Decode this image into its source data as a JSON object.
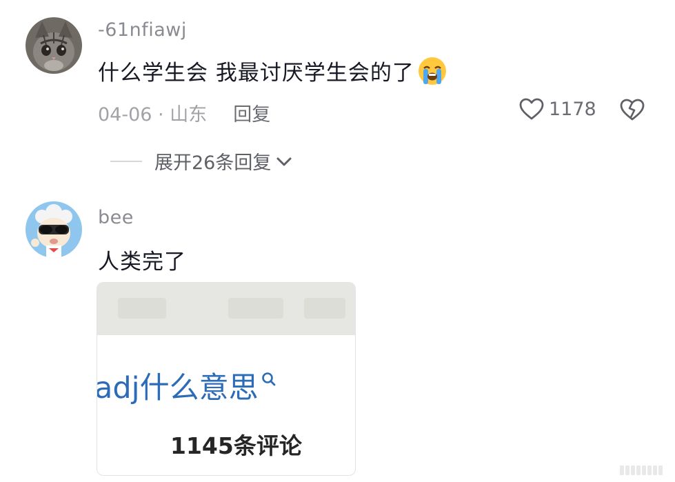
{
  "comments": [
    {
      "username": "-61nfiawj",
      "text": "什么学生会 我最讨厌学生会的了",
      "emoji": "loudly-crying-face-emoji",
      "date_location": "04-06 · 山东",
      "reply_label": "回复",
      "likes": "1178",
      "expand_label": "展开26条回复"
    },
    {
      "username": "bee",
      "text": "人类完了",
      "attachment": {
        "search_text": "adj什么意思",
        "count_text": "1145条评论"
      }
    }
  ],
  "icons": {
    "like": "heart-outline-icon",
    "dislike": "broken-heart-icon",
    "expand": "chevron-down-icon",
    "search": "search-icon"
  },
  "colors": {
    "link_blue": "#2c6bb8",
    "muted_text": "#a1a2a7",
    "primary_text": "#161823"
  }
}
